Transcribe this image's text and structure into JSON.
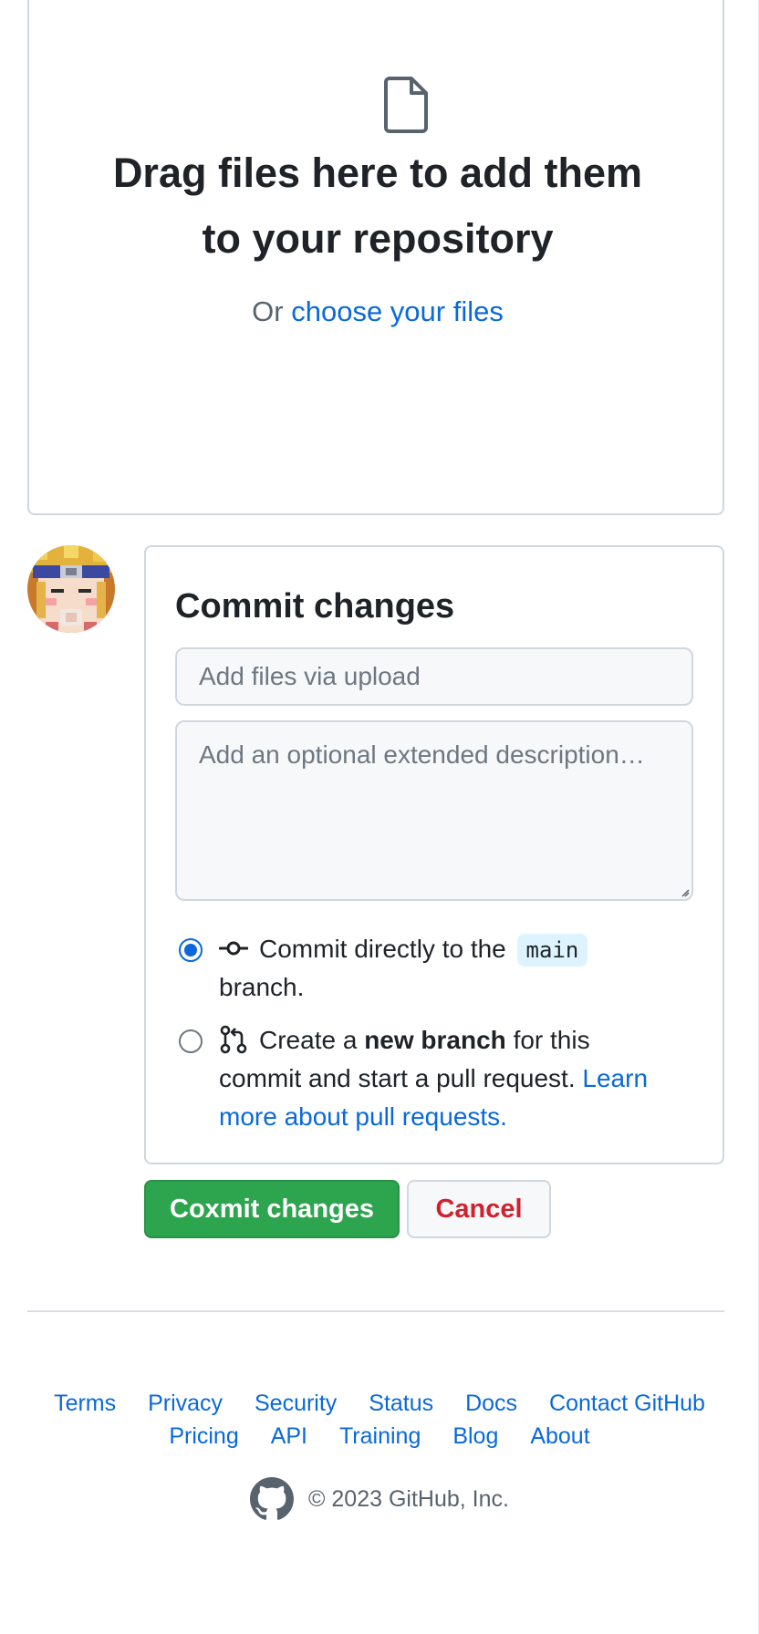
{
  "dropzone": {
    "icon": "file-icon",
    "title_line1": "Drag files here to add them",
    "title_line2": "to your repository",
    "or_text": "Or",
    "choose_link": "choose your files"
  },
  "avatar": {
    "icon": "user-avatar"
  },
  "commit": {
    "title": "Commit changes",
    "summary_placeholder": "Add files via upload",
    "description_placeholder": "Add an optional extended description…",
    "option_direct": {
      "checked": true,
      "icon": "git-commit-icon",
      "text_before": "Commit directly to the",
      "branch": "main",
      "text_after": "branch."
    },
    "option_new_branch": {
      "checked": false,
      "icon": "git-pull-request-icon",
      "text_before": "Create a",
      "bold": "new branch",
      "text_after": "for this commit and start a pull request.",
      "link": "Learn more about pull requests."
    }
  },
  "buttons": {
    "commit_label": "Coxmit changes",
    "cancel_label": "Cancel"
  },
  "footer": {
    "row1": [
      "Terms",
      "Privacy",
      "Security",
      "Status",
      "Docs",
      "Contact GitHub"
    ],
    "row2": [
      "Pricing",
      "API",
      "Training",
      "Blog",
      "About"
    ],
    "copyright": "© 2023 GitHub, Inc.",
    "logo_icon": "github-mark-icon"
  },
  "colors": {
    "accent": "#0969da",
    "primary_button": "#2da44e",
    "danger_text": "#cf222e",
    "border": "#d0d7de",
    "input_bg": "#f6f8fa",
    "branch_pill_bg": "#ddf4ff"
  }
}
